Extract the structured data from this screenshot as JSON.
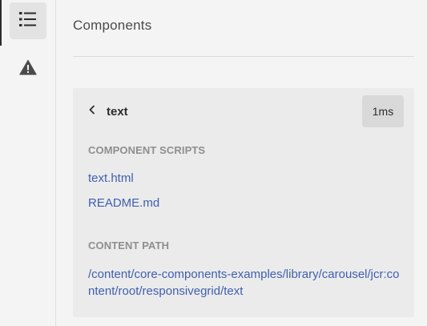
{
  "rail": {
    "items": [
      {
        "icon": "list-icon",
        "selected": true
      },
      {
        "icon": "alert-icon",
        "selected": false
      }
    ]
  },
  "main": {
    "heading": "Components",
    "panel": {
      "back_icon": "chevron-left-icon",
      "title": "text",
      "timing": "1ms",
      "scripts_label": "COMPONENT SCRIPTS",
      "scripts": [
        "text.html",
        "README.md"
      ],
      "content_path_label": "CONTENT PATH",
      "content_path": "/content/core-components-examples/library/carousel/jcr:content/root/responsivegrid/text"
    }
  },
  "colors": {
    "link": "#3f5fb0",
    "label": "#8e8e8e",
    "panel_bg": "#ebebeb",
    "badge_bg": "#d9d9d9"
  }
}
